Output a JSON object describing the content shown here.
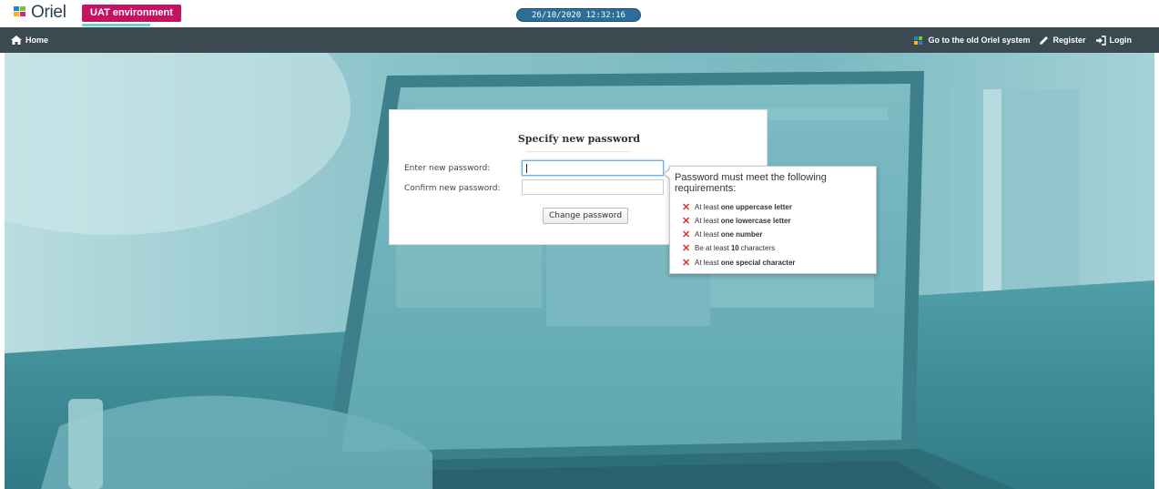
{
  "header": {
    "logo_text": "Oriel",
    "environment_badge": "UAT environment",
    "clock": "26/10/2020 12:32:16"
  },
  "nav": {
    "home_label": "Home",
    "old_system_label": "Go to the old Oriel system",
    "register_label": "Register",
    "login_label": "Login"
  },
  "form": {
    "title": "Specify new password",
    "new_password_label": "Enter new password:",
    "new_password_value": "",
    "confirm_password_label": "Confirm new password:",
    "confirm_password_value": "",
    "submit_label": "Change password"
  },
  "requirements": {
    "title": "Password must meet the following requirements:",
    "items": [
      {
        "prefix": "At least",
        "emphasis": "one uppercase letter",
        "suffix": ""
      },
      {
        "prefix": "At least",
        "emphasis": "one lowercase letter",
        "suffix": ""
      },
      {
        "prefix": "At least",
        "emphasis": "one number",
        "suffix": ""
      },
      {
        "prefix": "Be at least",
        "emphasis": "10",
        "suffix": "characters"
      },
      {
        "prefix": "At least",
        "emphasis": "one special character",
        "suffix": ""
      }
    ],
    "status_icon": "cross-icon",
    "status_color": "#d9312c"
  },
  "colors": {
    "badge": "#c6135f",
    "navbar": "#3b4a51",
    "clock": "#2b6f99"
  }
}
